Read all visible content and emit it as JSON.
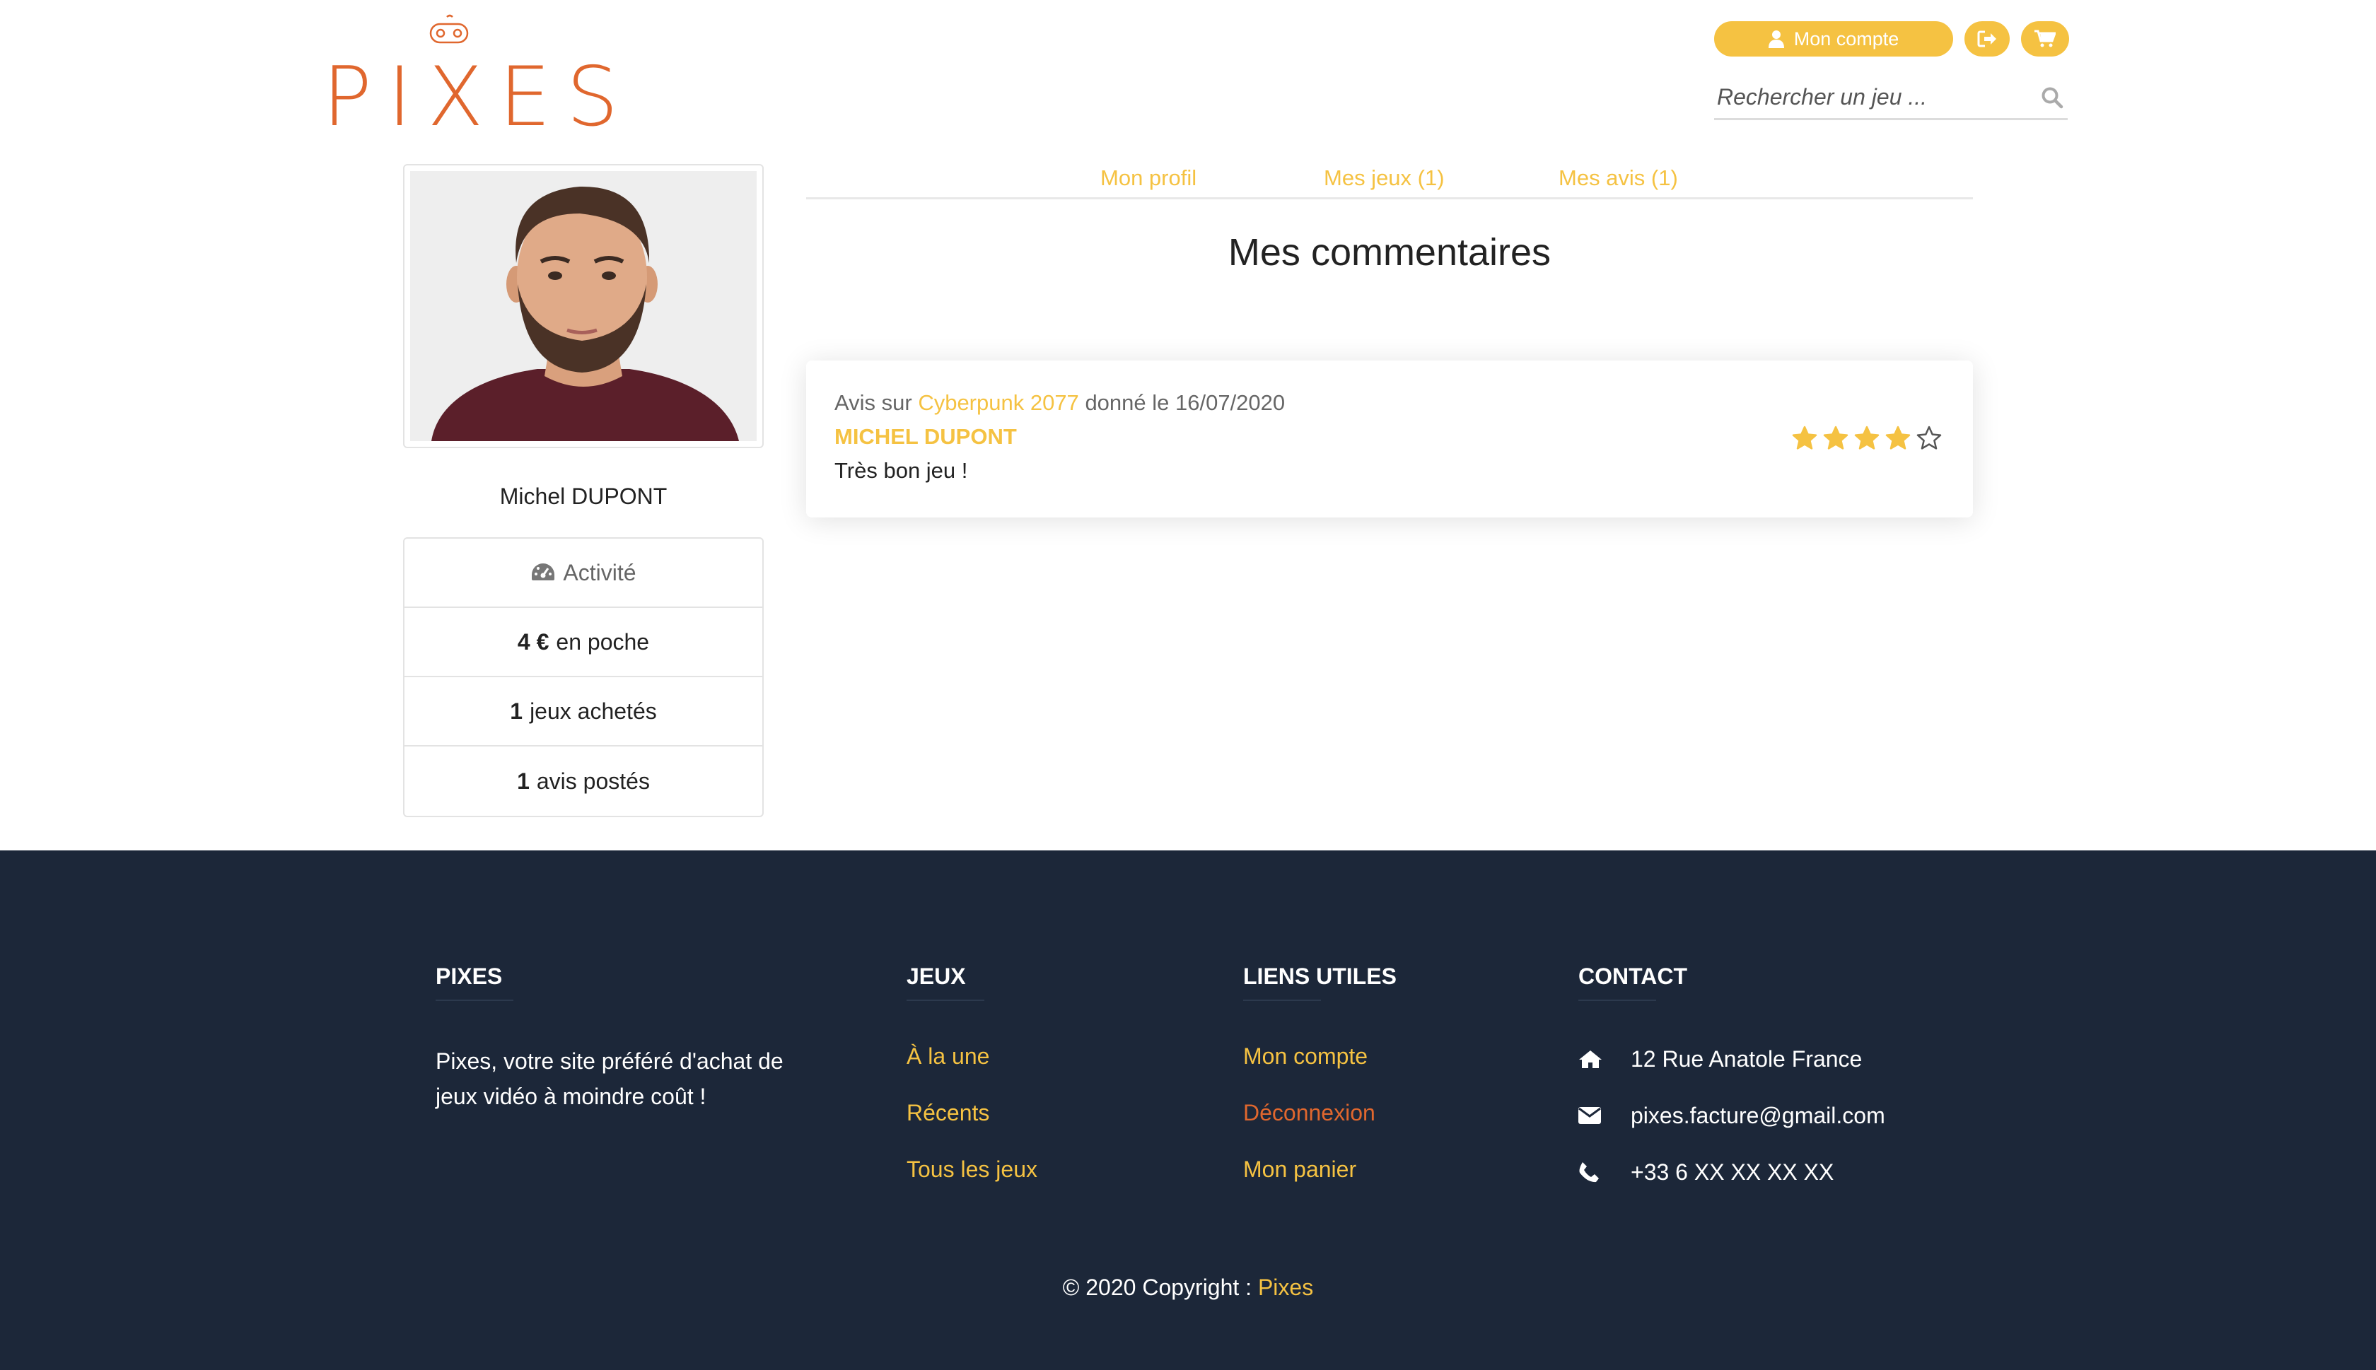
{
  "header": {
    "logo_text": "PIXES",
    "account_label": "Mon compte",
    "search_placeholder": "Rechercher un jeu ..."
  },
  "profile": {
    "name": "Michel DUPONT",
    "stats": {
      "activity_label": "Activité",
      "wallet_value": "4 €",
      "wallet_suffix": "en poche",
      "games_value": "1",
      "games_suffix": "jeux achetés",
      "reviews_value": "1",
      "reviews_suffix": "avis postés"
    }
  },
  "tabs": [
    {
      "label": "Mon profil"
    },
    {
      "label": "Mes jeux (1)"
    },
    {
      "label": "Mes avis (1)"
    }
  ],
  "main": {
    "title": "Mes commentaires",
    "review": {
      "prefix": "Avis sur",
      "game": "Cyberpunk 2077",
      "date_text": "donné le 16/07/2020",
      "author": "MICHEL DUPONT",
      "comment": "Très bon jeu !",
      "rating": 4,
      "rating_max": 5
    }
  },
  "footer": {
    "col1": {
      "title": "PIXES",
      "text": "Pixes, votre site préféré d'achat de jeux vidéo à moindre coût !"
    },
    "col2": {
      "title": "JEUX",
      "links": [
        "À la une",
        "Récents",
        "Tous les jeux"
      ]
    },
    "col3": {
      "title": "LIENS UTILES",
      "links": [
        "Mon compte",
        "Déconnexion",
        "Mon panier"
      ]
    },
    "col4": {
      "title": "CONTACT",
      "address": "12 Rue Anatole France",
      "email": "pixes.facture@gmail.com",
      "phone": "+33 6 XX XX XX XX"
    },
    "copyright_prefix": "© 2020 Copyright :",
    "copyright_brand": "Pixes"
  },
  "colors": {
    "accent": "#f5c242",
    "brand_orange": "#e0672e",
    "footer_bg": "#1c2739"
  },
  "icons": [
    "gamepad-icon",
    "user-icon",
    "logout-icon",
    "cart-icon",
    "search-icon",
    "dashboard-icon",
    "star-icon",
    "home-icon",
    "envelope-icon",
    "phone-icon"
  ]
}
